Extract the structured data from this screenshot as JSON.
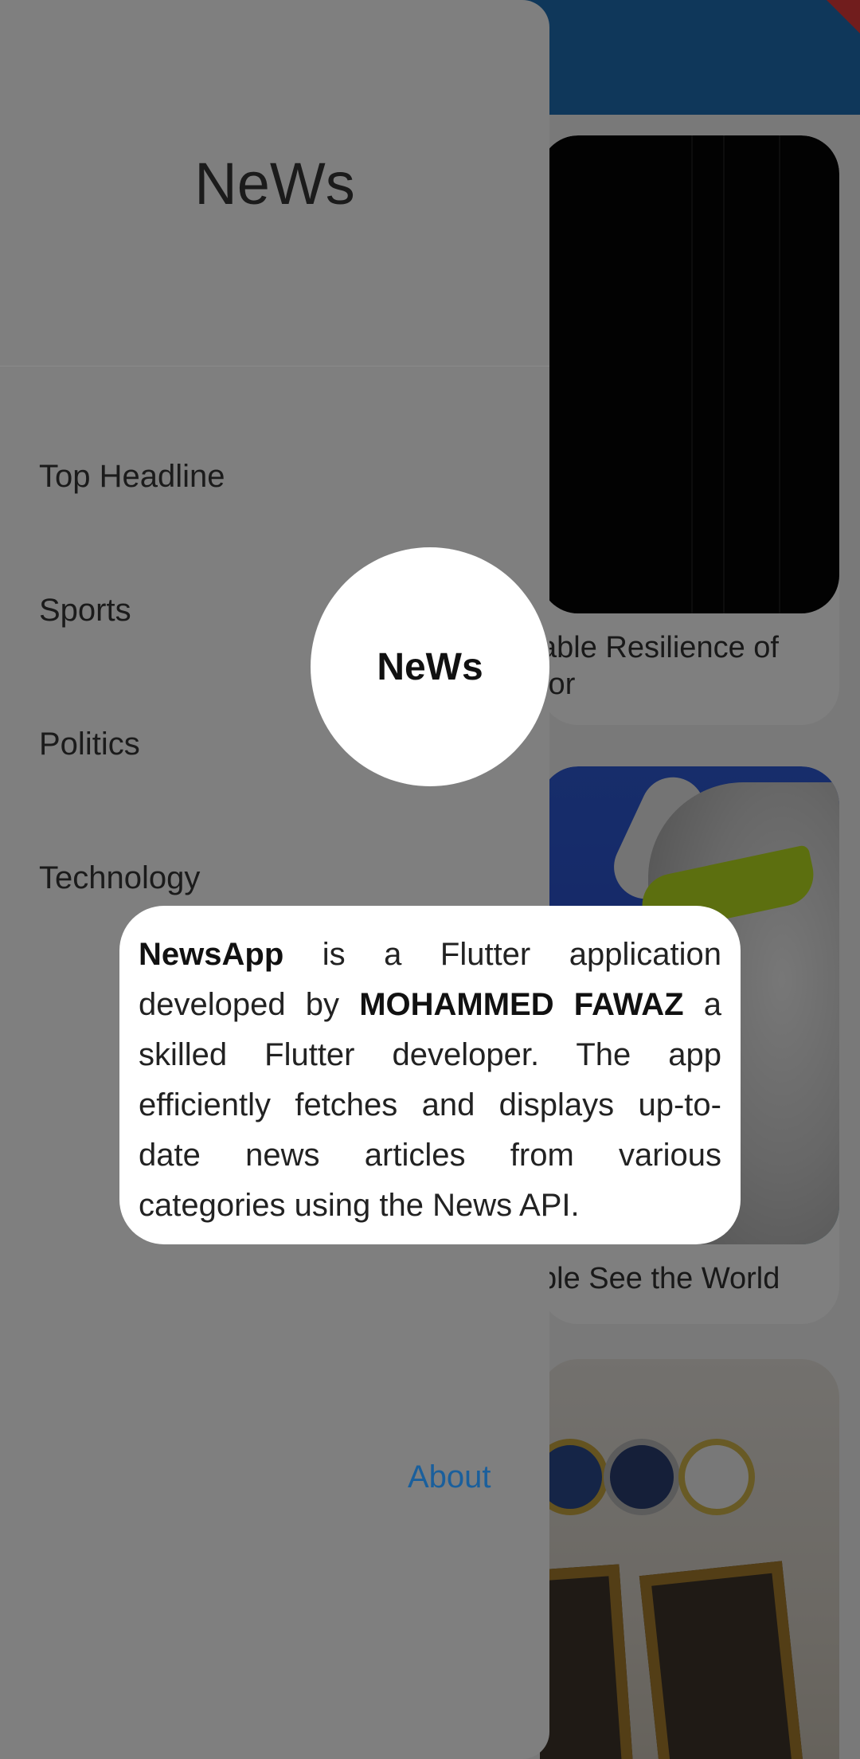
{
  "drawer": {
    "title": "NeWs",
    "menu": [
      {
        "label": "Top Headline"
      },
      {
        "label": "Sports"
      },
      {
        "label": "Politics"
      },
      {
        "label": "Technology"
      }
    ],
    "about_link": "About"
  },
  "about_dialog": {
    "logo_text": "NeWs",
    "text_segments": [
      {
        "text": "NewsApp",
        "bold": true
      },
      {
        "text": " is a Flutter application developed by ",
        "bold": false
      },
      {
        "text": "MOHAMMED FAWAZ",
        "bold": true
      },
      {
        "text": " a skilled Flutter developer. The app efficiently fetches and displays up-to-date news articles from various categories using the News API.",
        "bold": false
      }
    ]
  },
  "background": {
    "cards": [
      {
        "title_visible": "able Resilience of",
        "title_visible_line2": "tor"
      },
      {
        "title_visible": "ple See the World"
      }
    ]
  },
  "colors": {
    "appbar": "#1f6fb5",
    "drawer": "#7f7f7f",
    "about_link": "#1a5f9c"
  }
}
